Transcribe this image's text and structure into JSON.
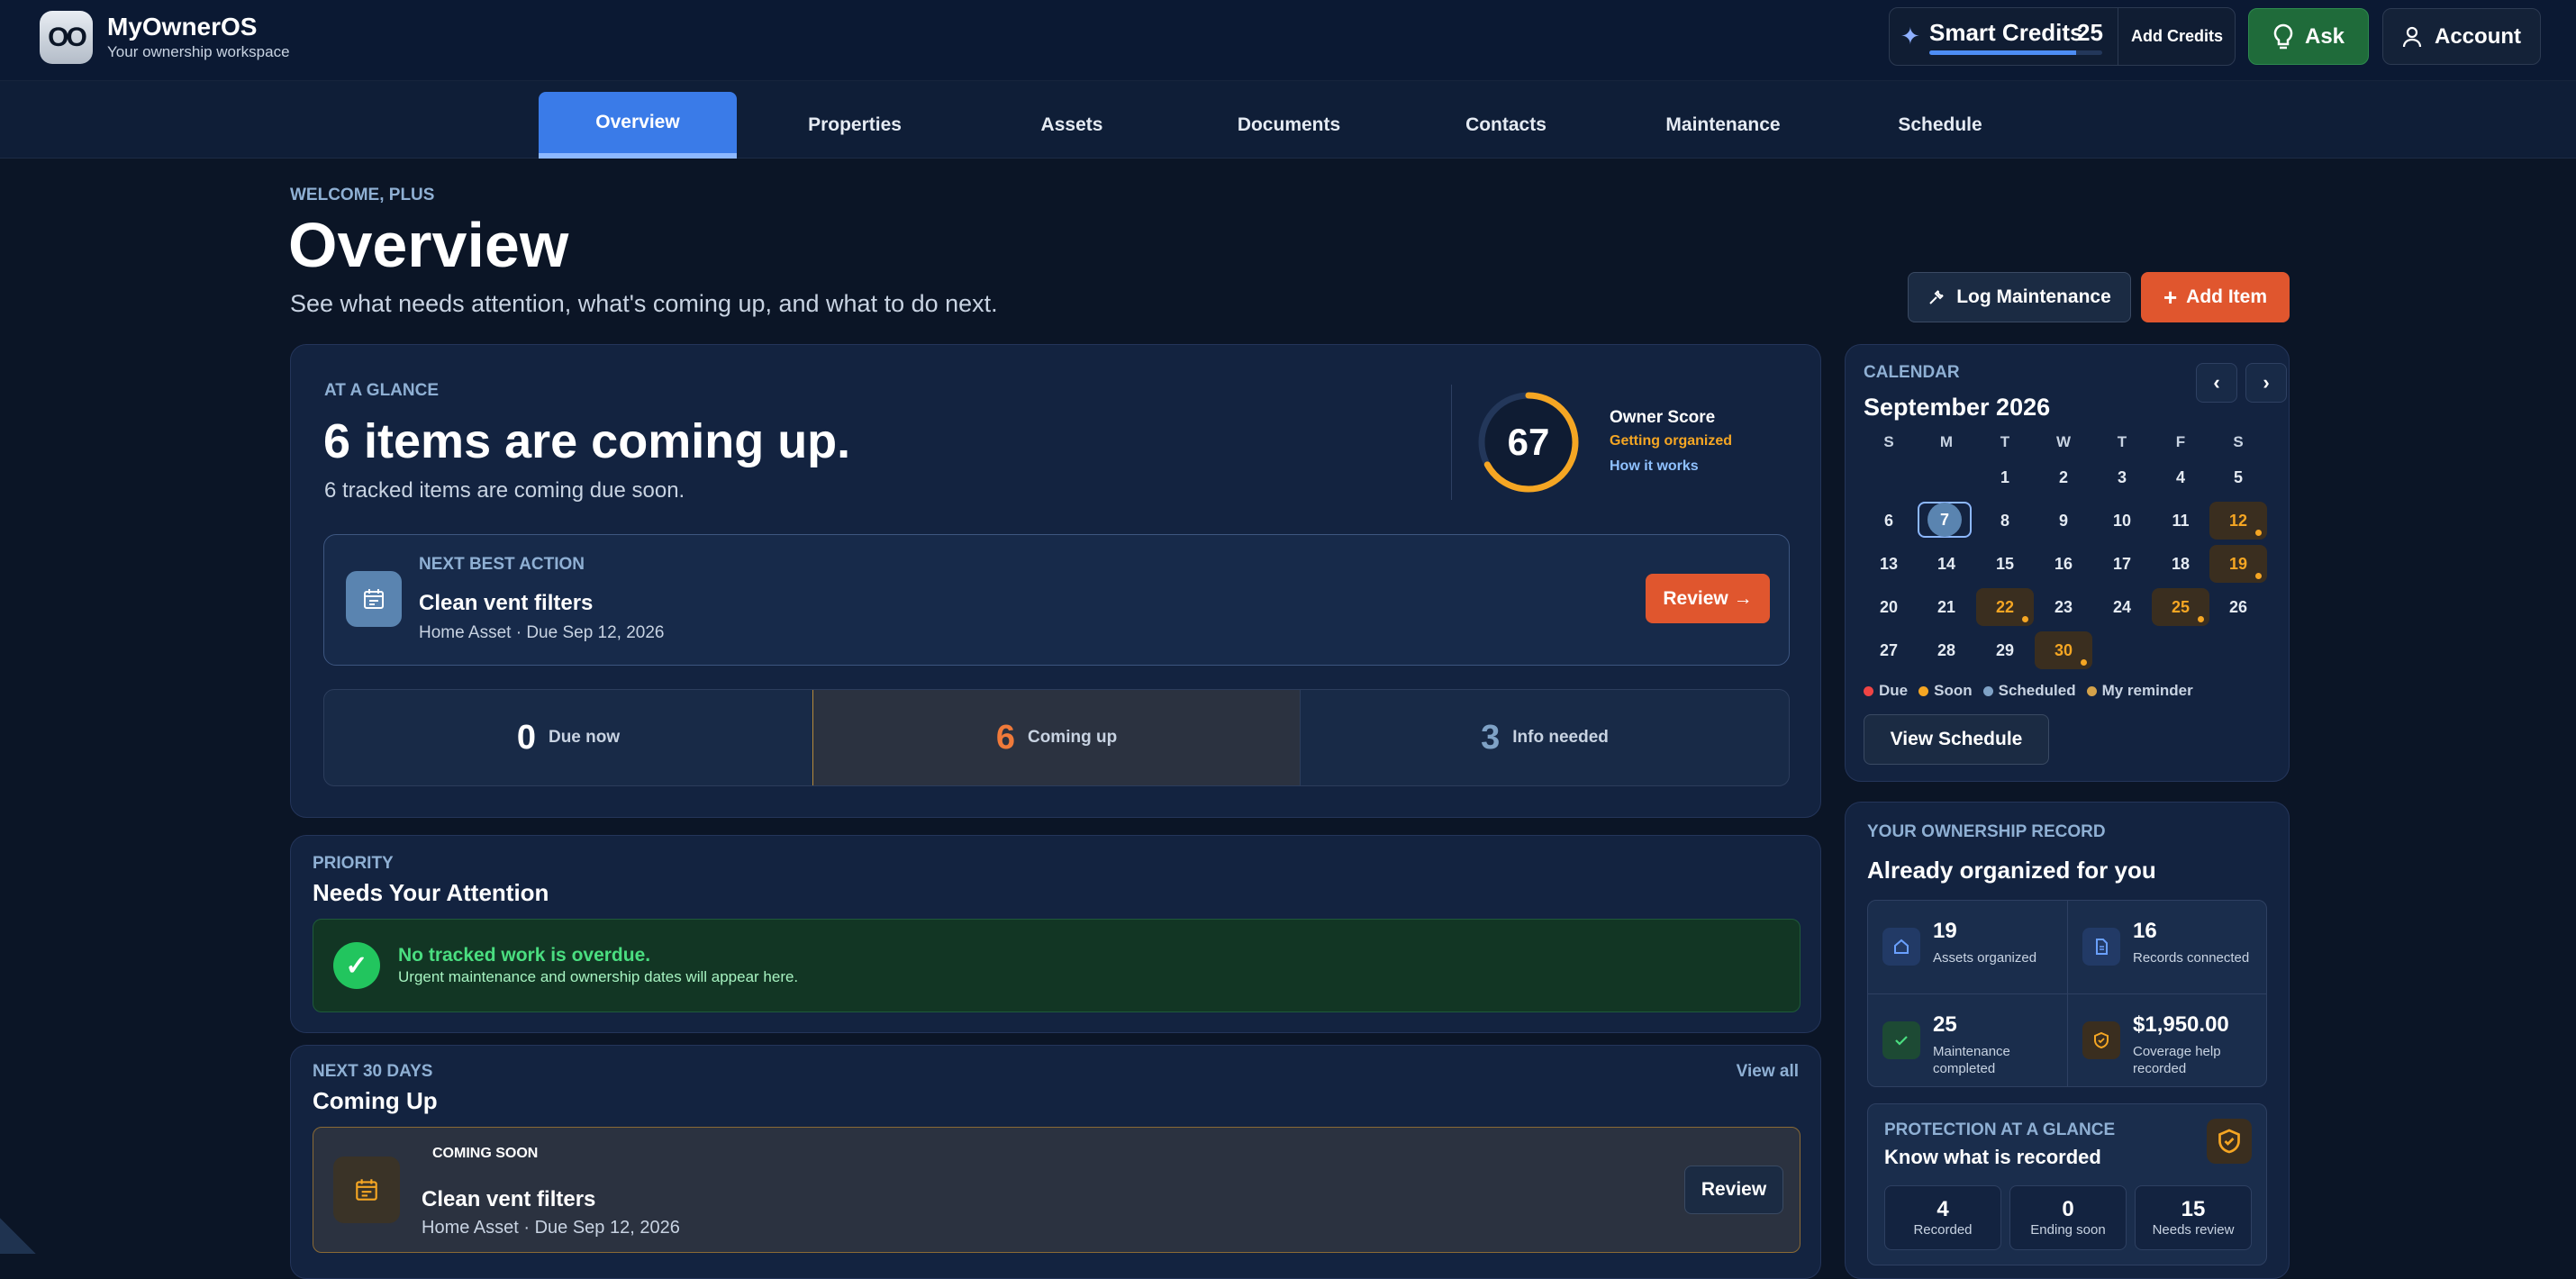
{
  "brand": {
    "logo": "OO",
    "name": "MyOwnerOS",
    "tagline": "Your ownership workspace"
  },
  "header": {
    "credits_label": "Smart Credits",
    "credits_value": "25",
    "credits_fill": 0.85,
    "add_credits": "Add Credits",
    "ask": "Ask",
    "account": "Account"
  },
  "tabs": [
    {
      "label": "Overview"
    },
    {
      "label": "Properties"
    },
    {
      "label": "Assets"
    },
    {
      "label": "Documents"
    },
    {
      "label": "Contacts"
    },
    {
      "label": "Maintenance"
    },
    {
      "label": "Schedule"
    }
  ],
  "page": {
    "welcome": "WELCOME, PLUS",
    "title": "Overview",
    "subtitle": "See what needs attention, what's coming up, and what to do next.",
    "log_btn": "Log Maintenance",
    "add_btn": "Add Item"
  },
  "glance": {
    "eyebrow": "AT A GLANCE",
    "headline": "6 items are coming up.",
    "sub": "6 tracked items are coming due soon.",
    "score": {
      "value": "67",
      "fraction": 0.67,
      "label": "Owner Score",
      "status": "Getting organized",
      "link": "How it works"
    },
    "nba": {
      "eyebrow": "NEXT BEST ACTION",
      "title": "Clean vent filters",
      "meta": "Home Asset · Due Sep 12, 2026",
      "btn": "Review →"
    },
    "stats": [
      {
        "n": "0",
        "l": "Due now",
        "color": "#ffffff"
      },
      {
        "n": "6",
        "l": "Coming up",
        "color": "#f07a3a"
      },
      {
        "n": "3",
        "l": "Info needed",
        "color": "#7fa2c6"
      }
    ]
  },
  "priority": {
    "eyebrow": "PRIORITY",
    "title": "Needs Your Attention",
    "ok_title": "No tracked work is overdue.",
    "ok_msg": "Urgent maintenance and ownership dates will appear here."
  },
  "next": {
    "eyebrow": "NEXT 30 DAYS",
    "title": "Coming Up",
    "view_all": "View all",
    "item": {
      "kicker": "COMING SOON",
      "title": "Clean vent filters",
      "meta": "Home Asset · Due Sep 12, 2026",
      "btn": "Review"
    }
  },
  "calendar": {
    "eyebrow": "CALENDAR",
    "month": "September 2026",
    "prev": "‹",
    "next": "›",
    "dows": [
      "S",
      "M",
      "T",
      "W",
      "T",
      "F",
      "S"
    ],
    "weeks": [
      [
        "",
        "",
        "1",
        "2",
        "3",
        "4",
        "5"
      ],
      [
        "6",
        "7",
        "8",
        "9",
        "10",
        "11",
        "12"
      ],
      [
        "13",
        "14",
        "15",
        "16",
        "17",
        "18",
        "19"
      ],
      [
        "20",
        "21",
        "22",
        "23",
        "24",
        "25",
        "26"
      ],
      [
        "27",
        "28",
        "29",
        "30",
        "",
        "",
        ""
      ]
    ],
    "today": "7",
    "soon_days": [
      "12",
      "19",
      "22",
      "25",
      "30"
    ],
    "legend": [
      {
        "l": "Due",
        "c": "#ef4444"
      },
      {
        "l": "Soon",
        "c": "#f5a623"
      },
      {
        "l": "Scheduled",
        "c": "#7fa2c6"
      },
      {
        "l": "My reminder",
        "c": "#d4a24a"
      }
    ],
    "view_btn": "View Schedule"
  },
  "record": {
    "eyebrow": "YOUR OWNERSHIP RECORD",
    "title": "Already organized for you",
    "cells": [
      {
        "n": "19",
        "l": "Assets organized",
        "icon": "home-icon"
      },
      {
        "n": "16",
        "l": "Records connected",
        "icon": "document-icon"
      },
      {
        "n": "25",
        "l": "Maintenance completed",
        "icon": "check-icon"
      },
      {
        "n": "$1,950.00",
        "l": "Coverage help recorded",
        "icon": "shield-icon"
      }
    ]
  },
  "protection": {
    "eyebrow": "PROTECTION AT A GLANCE",
    "title": "Know what is recorded",
    "boxes": [
      {
        "n": "4",
        "l": "Recorded"
      },
      {
        "n": "0",
        "l": "Ending soon"
      },
      {
        "n": "15",
        "l": "Needs review"
      }
    ]
  }
}
